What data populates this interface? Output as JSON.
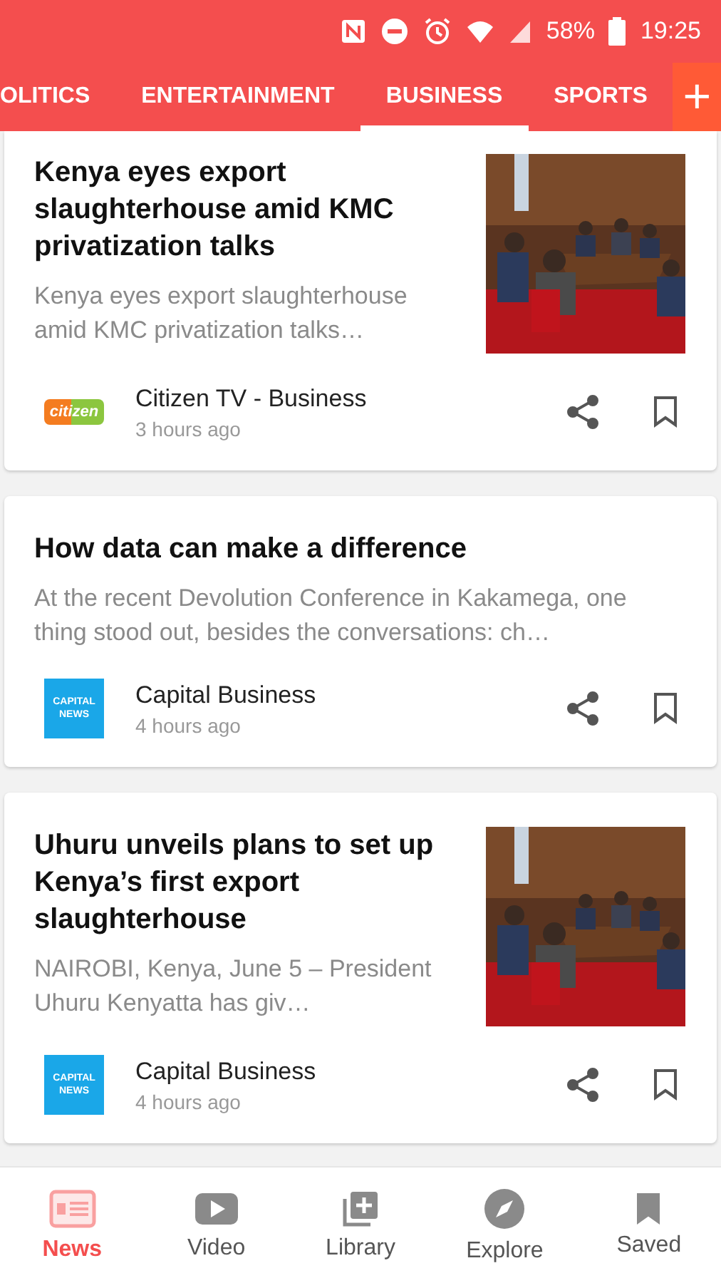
{
  "status_bar": {
    "battery": "58%",
    "time": "19:25"
  },
  "tabs": [
    {
      "label": "OLITICS",
      "selected": false
    },
    {
      "label": "ENTERTAINMENT",
      "selected": false
    },
    {
      "label": "BUSINESS",
      "selected": true
    },
    {
      "label": "SPORTS",
      "selected": false
    }
  ],
  "add_tab_button": "+",
  "articles": [
    {
      "title": "Kenya eyes export slaughterhouse amid KMC privatization talks",
      "summary": "Kenya eyes export slaughterhouse amid KMC privatization talks…",
      "source": "Citizen TV - Business",
      "source_logo": {
        "kind": "citizen",
        "text": "citizen"
      },
      "time": "3 hours ago"
    },
    {
      "title": "How data can make a difference",
      "summary": "At the recent Devolution Conference in Kakamega, one thing stood out, besides the conversations: ch…",
      "source": "Capital Business",
      "source_logo": {
        "kind": "capital",
        "text": "CAPITAL NEWS"
      },
      "time": "4 hours ago"
    },
    {
      "title": "Uhuru unveils plans to set up Kenya’s first export slaughterhouse",
      "summary": "NAIROBI, Kenya, June 5 – President Uhuru Kenyatta has giv…",
      "source": "Capital Business",
      "source_logo": {
        "kind": "capital",
        "text": "CAPITAL NEWS"
      },
      "time": "4 hours ago"
    }
  ],
  "bottom_nav": [
    {
      "kind": "news",
      "label": "News",
      "selected": true
    },
    {
      "kind": "video",
      "label": "Video",
      "selected": false
    },
    {
      "kind": "library",
      "label": "Library",
      "selected": false
    },
    {
      "kind": "explore",
      "label": "Explore",
      "selected": false
    },
    {
      "kind": "saved",
      "label": "Saved",
      "selected": false
    }
  ]
}
